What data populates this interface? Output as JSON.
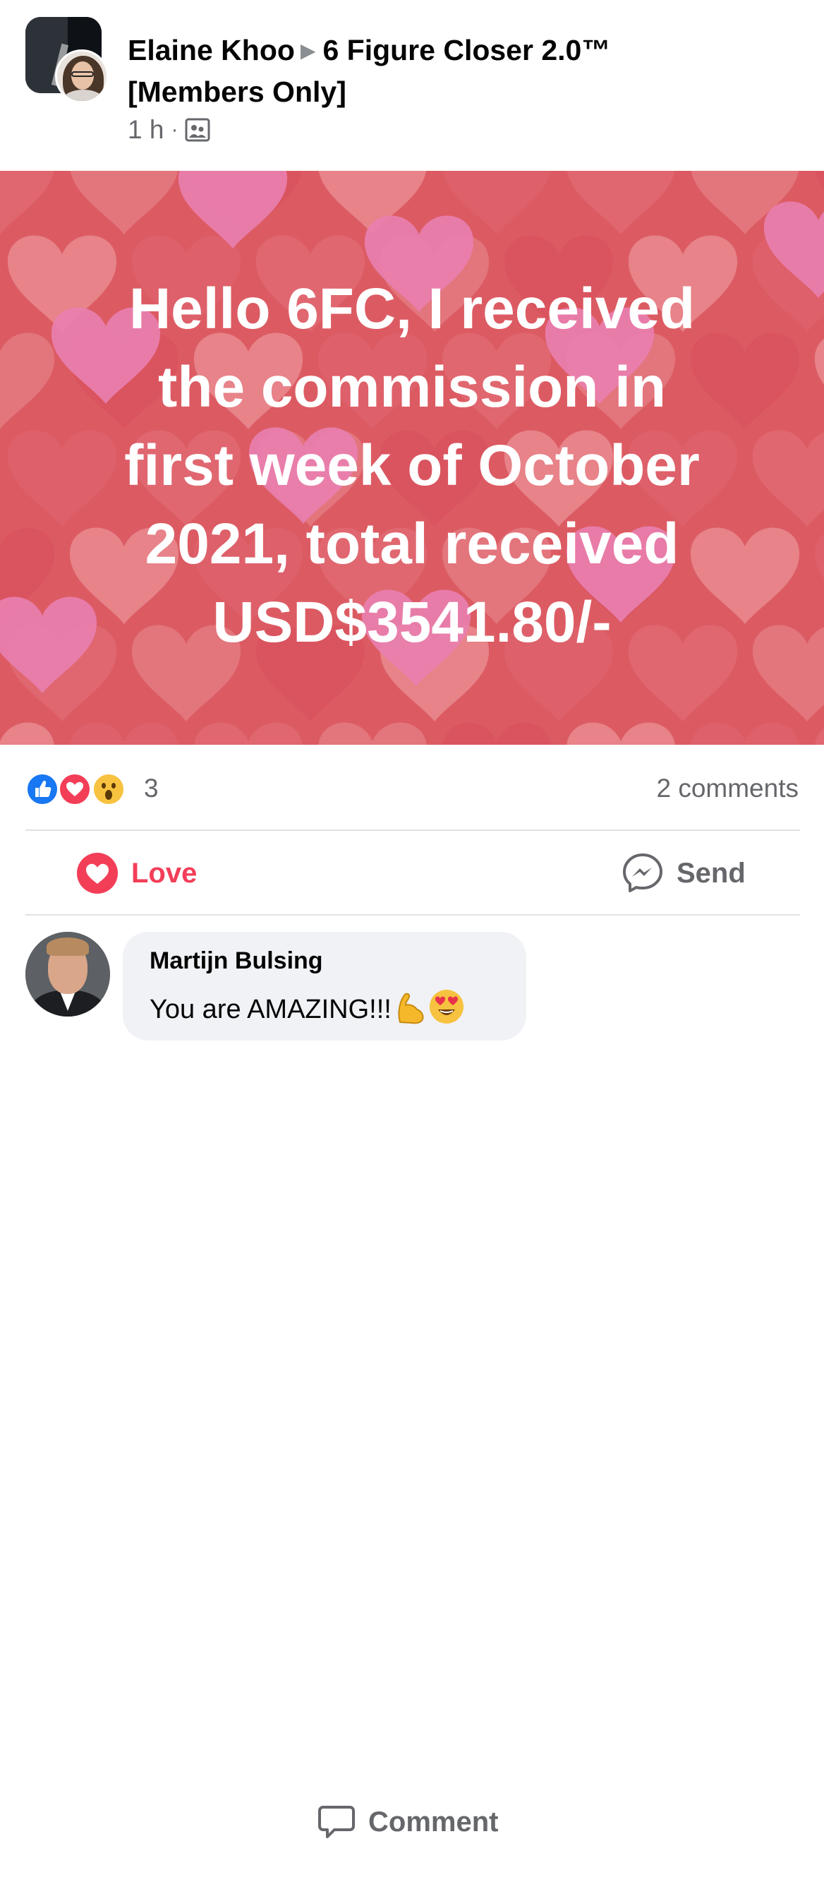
{
  "post": {
    "author": "Elaine Khoo",
    "group": "6 Figure Closer 2.0™",
    "group_line2": "[Members Only]",
    "timestamp": "1 h",
    "separator": "·",
    "audience_icon": "group-members-icon"
  },
  "image": {
    "background_color": "#dc5b63",
    "lines": [
      "Hello 6FC, I received",
      "the commission in",
      "first week of October",
      "2021, total received",
      "USD$3541.80/-"
    ]
  },
  "reactions": {
    "icons": [
      "like-icon",
      "love-icon",
      "wow-icon"
    ],
    "count": "3",
    "comments_label": "2 comments"
  },
  "actions": {
    "love_label": "Love",
    "comment_label": "Comment",
    "send_label": "Send"
  },
  "comment": {
    "name": "Martijn Bulsing",
    "text": "You are AMAZING!!!",
    "emojis": [
      "flexed-biceps-icon",
      "heart-eyes-icon"
    ]
  },
  "colors": {
    "love": "#f33e58",
    "like": "#1877f2",
    "wow": "#f7c23f",
    "secondary_text": "#65676b"
  }
}
